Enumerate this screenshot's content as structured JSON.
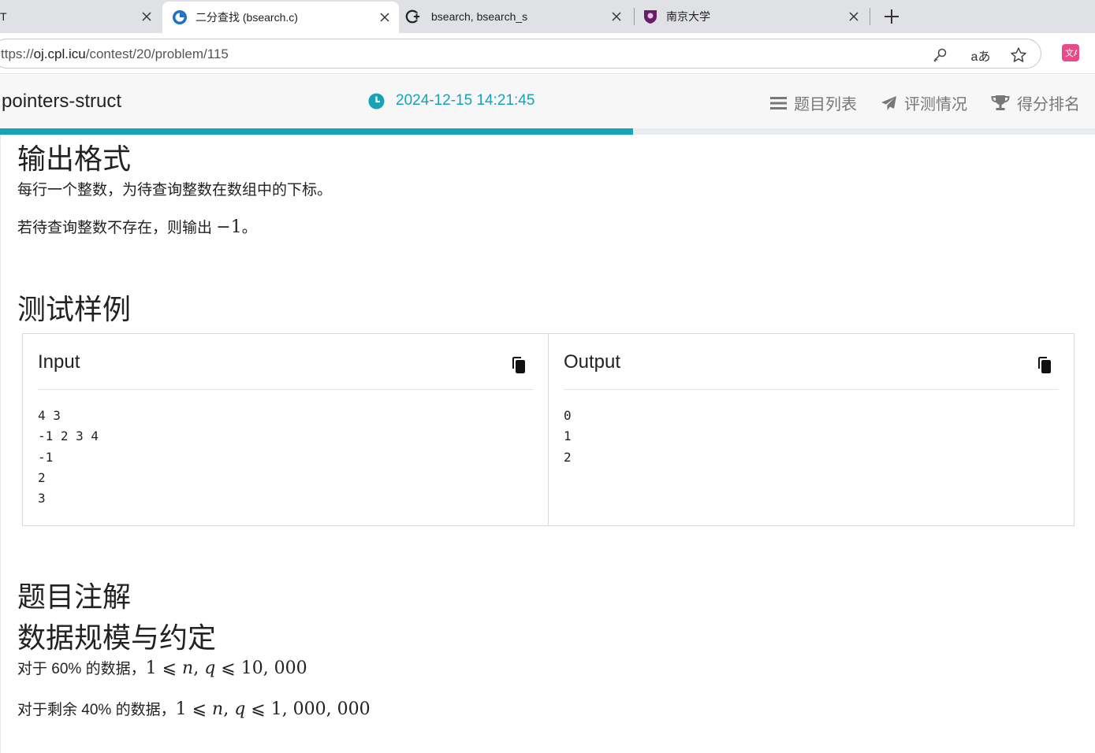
{
  "browser": {
    "tabs": [
      {
        "title": "T",
        "favicon": "partial-tab-icon"
      },
      {
        "title": "二分查找 (bsearch.c)",
        "favicon": "cpl-oj-icon",
        "active": true
      },
      {
        "title": "bsearch, bsearch_s",
        "favicon": "cppreference-icon"
      },
      {
        "title": "南京大学",
        "favicon": "nju-crest-icon"
      }
    ],
    "new_tab_label": "+",
    "url_prefix": "ttps://",
    "url_host": "oj.cpl.icu",
    "url_path": "/contest/20/problem/115"
  },
  "header": {
    "title": "pointers-struct",
    "datetime": "2024-12-15 14:21:45",
    "nav": [
      {
        "label": "题目列表",
        "icon": "list-icon"
      },
      {
        "label": "评测情况",
        "icon": "paper-plane-icon"
      },
      {
        "label": "得分排名",
        "icon": "trophy-icon"
      }
    ],
    "progress": 0.578,
    "accent": "#17a2b8"
  },
  "content": {
    "output_format": {
      "heading": "输出格式",
      "line1": "每行一个整数，为待查询整数在数组中的下标。",
      "line2_text": "若待查询整数不存在，则输出 ",
      "line2_math": "−1",
      "line2_end": "。"
    },
    "samples": {
      "heading": "测试样例",
      "input_label": "Input",
      "output_label": "Output",
      "input_text": "4 3\n-1 2 3 4\n-1\n2\n3",
      "output_text": "0\n1\n2"
    },
    "notes": {
      "heading": "题目注解",
      "subheading": "数据规模与约定",
      "line1_text": "对于 60% 的数据，",
      "line1_math_a": "1 ⩽ ",
      "line1_math_vars": "n",
      "line1_math_q": "q",
      "line1_math_b": " ⩽ 10, 000",
      "line2_text": "对于剩余 40% 的数据，",
      "line2_math_a": "1 ⩽ ",
      "line2_math_vars": "n",
      "line2_math_q": "q",
      "line2_math_b": " ⩽ 1, 000, 000"
    }
  }
}
